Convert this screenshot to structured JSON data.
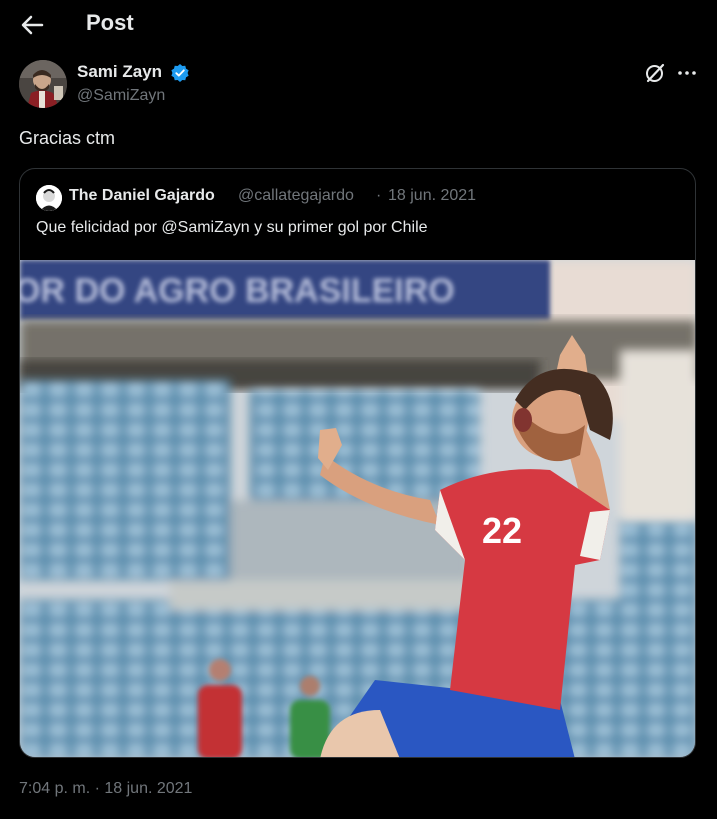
{
  "header": {
    "title": "Post"
  },
  "post": {
    "author_name": "Sami Zayn",
    "author_handle": "@SamiZayn",
    "text": "Gracias ctm",
    "timestamp": "7:04 p. m. · 18 jun. 2021"
  },
  "quote": {
    "author_name": "The Daniel Gajardo",
    "author_handle": "@callategajardo",
    "separator": "·",
    "date": "18 jun. 2021",
    "text": "Que felicidad por @SamiZayn y su primer gol por Chile",
    "media": {
      "banner_text": "OR DO AGRO BRASILEIRO",
      "jersey_number": "22"
    }
  },
  "colors": {
    "background": "#000000",
    "text_primary": "#e7e9ea",
    "text_secondary": "#71767b",
    "border": "#2f3336",
    "verified": "#1d9bf0"
  },
  "icons": [
    "back-arrow-icon",
    "verified-badge-icon",
    "grok-icon",
    "more-icon"
  ]
}
